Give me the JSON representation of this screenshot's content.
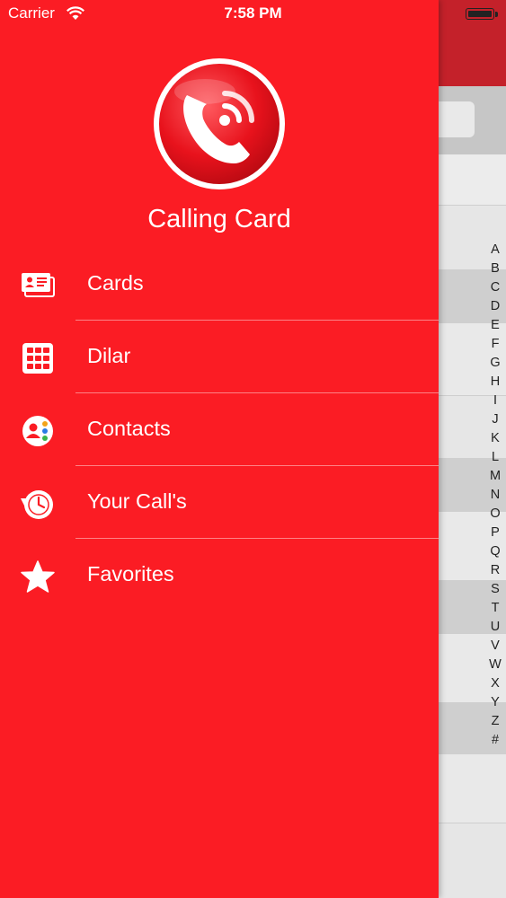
{
  "status_bar": {
    "carrier": "Carrier",
    "time": "7:58 PM"
  },
  "drawer": {
    "title": "Calling Card",
    "menu": [
      {
        "label": "Cards",
        "icon": "id-card-icon"
      },
      {
        "label": "Dilar",
        "icon": "dialpad-icon"
      },
      {
        "label": "Contacts",
        "icon": "contacts-icon"
      },
      {
        "label": "Your Call's",
        "icon": "call-history-icon"
      },
      {
        "label": "Favorites",
        "icon": "star-icon"
      }
    ]
  },
  "alphabet_index": [
    "A",
    "B",
    "C",
    "D",
    "E",
    "F",
    "G",
    "H",
    "I",
    "J",
    "K",
    "L",
    "M",
    "N",
    "O",
    "P",
    "Q",
    "R",
    "S",
    "T",
    "U",
    "V",
    "W",
    "X",
    "Y",
    "Z",
    "#"
  ],
  "colors": {
    "drawer": "#fb1c24",
    "navbar": "#c4212a",
    "text": "#ffffff"
  }
}
